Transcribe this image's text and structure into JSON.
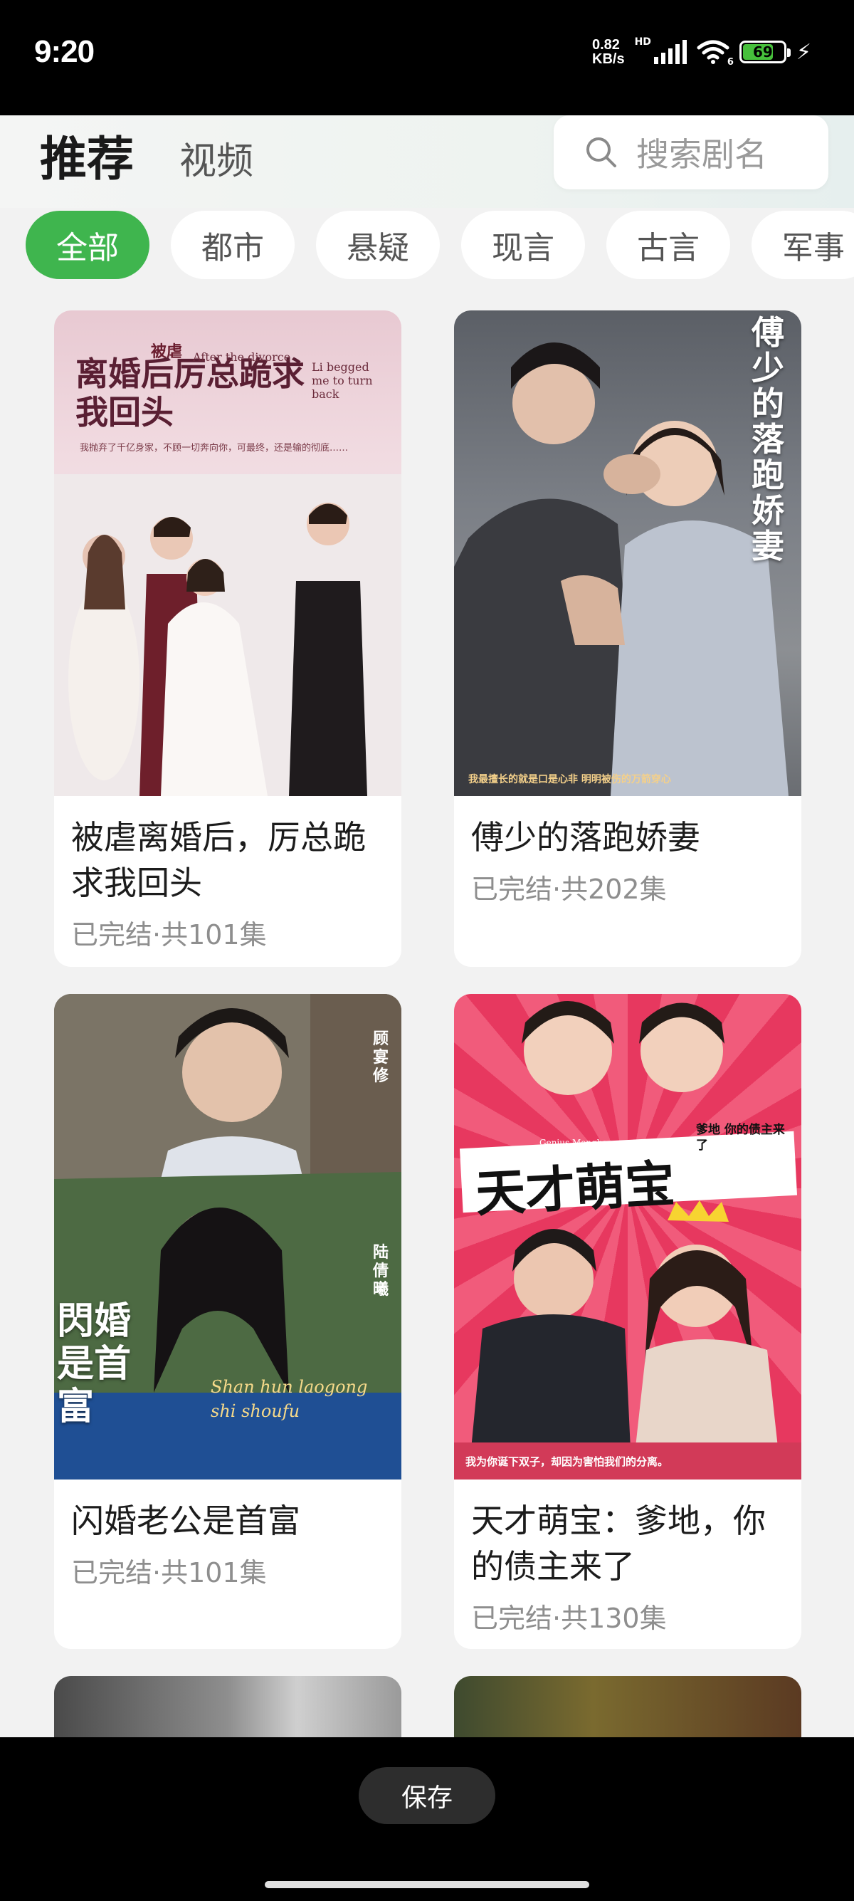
{
  "status_bar": {
    "time": "9:20",
    "net_speed_value": "0.82",
    "net_speed_unit": "KB/s",
    "hd_label": "HD",
    "wifi_label": "6",
    "battery_percent": "69"
  },
  "header": {
    "title": "推荐",
    "subtitle": "视频",
    "search_placeholder": "搜索剧名"
  },
  "tabs": [
    {
      "label": "全部",
      "active": true
    },
    {
      "label": "都市",
      "active": false
    },
    {
      "label": "悬疑",
      "active": false
    },
    {
      "label": "现言",
      "active": false
    },
    {
      "label": "古言",
      "active": false
    },
    {
      "label": "军事",
      "active": false
    }
  ],
  "dramas": [
    {
      "title": "被虐离婚后，厉总跪求我回头",
      "meta": "已完结·共101集",
      "poster_text": {
        "main": "离婚后厉总跪求我回头",
        "small": "被虐",
        "en1": "After the divorce",
        "en2": "Li begged me to turn back",
        "tagline": "我抛弃了千亿身家，不顾一切奔向你，可最终，还是输的彻底……"
      }
    },
    {
      "title": "傅少的落跑娇妻",
      "meta": "已完结·共202集",
      "poster_text": {
        "main": "傅少的落跑娇妻",
        "tagline": "我最擅长的就是口是心非 明明被伤的万箭穿心"
      }
    },
    {
      "title": "闪婚老公是首富",
      "meta": "已完结·共101集",
      "poster_text": {
        "main": "閃婚是首富",
        "en": "Shan hun laogong shi shoufu",
        "name1": "顾宴修",
        "name2": "陆倩曦"
      }
    },
    {
      "title": "天才萌宝：爹地，你的债主来了",
      "meta": "已完结·共130集",
      "poster_text": {
        "main": "天才萌宝",
        "en": "Genius Mengbao",
        "sub": "爹地 你的债主来了",
        "tagline": "我为你诞下双子，却因为害怕我们的分离。"
      }
    }
  ],
  "bottom_bar": {
    "save_label": "保存"
  },
  "colors": {
    "accent": "#3fb54e",
    "background": "#f2f2f2"
  }
}
